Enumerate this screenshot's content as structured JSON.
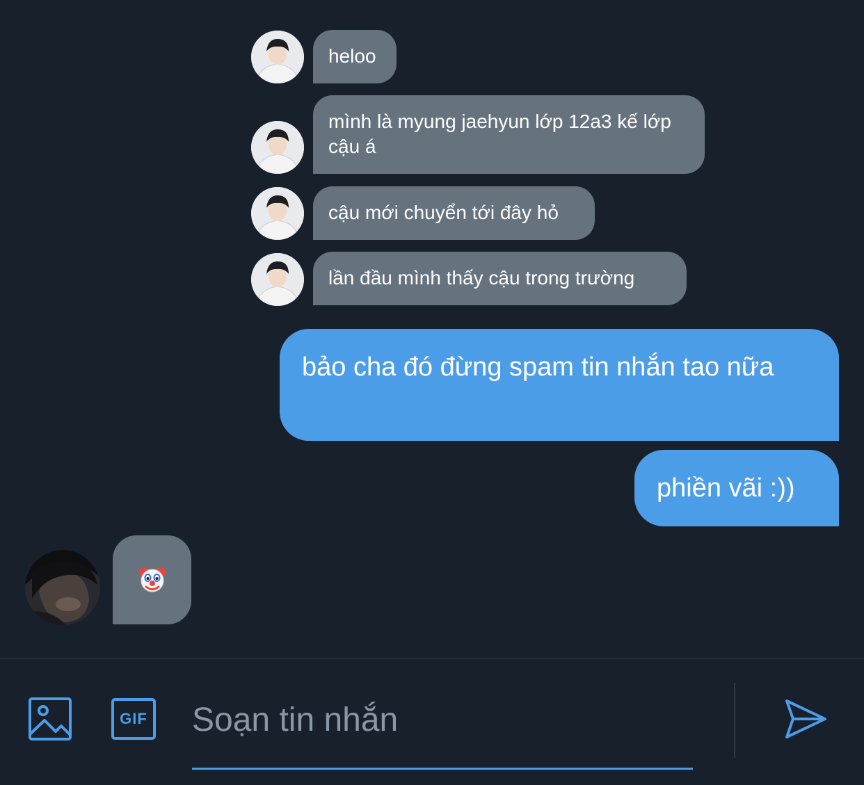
{
  "conversation": {
    "incoming_messages": [
      {
        "text": "heloo"
      },
      {
        "text": "mình là myung jaehyun lớp 12a3 kế lớp cậu á"
      },
      {
        "text": "cậu mới chuyển tới đây hỏ"
      },
      {
        "text": "lần đầu mình thấy cậu trong trường"
      }
    ],
    "outgoing_messages": [
      {
        "text": "bảo cha đó đừng spam tin nhắn tao nữa"
      },
      {
        "text": "phiền vãi :))"
      }
    ],
    "reply_message": {
      "emoji": "🤡",
      "emoji_name": "clown-face"
    }
  },
  "composer": {
    "placeholder": "Soạn tin nhắn",
    "image_icon": "image-icon",
    "gif_label": "GIF",
    "send_icon": "send-icon"
  },
  "colors": {
    "background": "#18202b",
    "incoming_bubble": "#66737f",
    "outgoing_bubble": "#4c9de8",
    "accent": "#4c9de8"
  }
}
